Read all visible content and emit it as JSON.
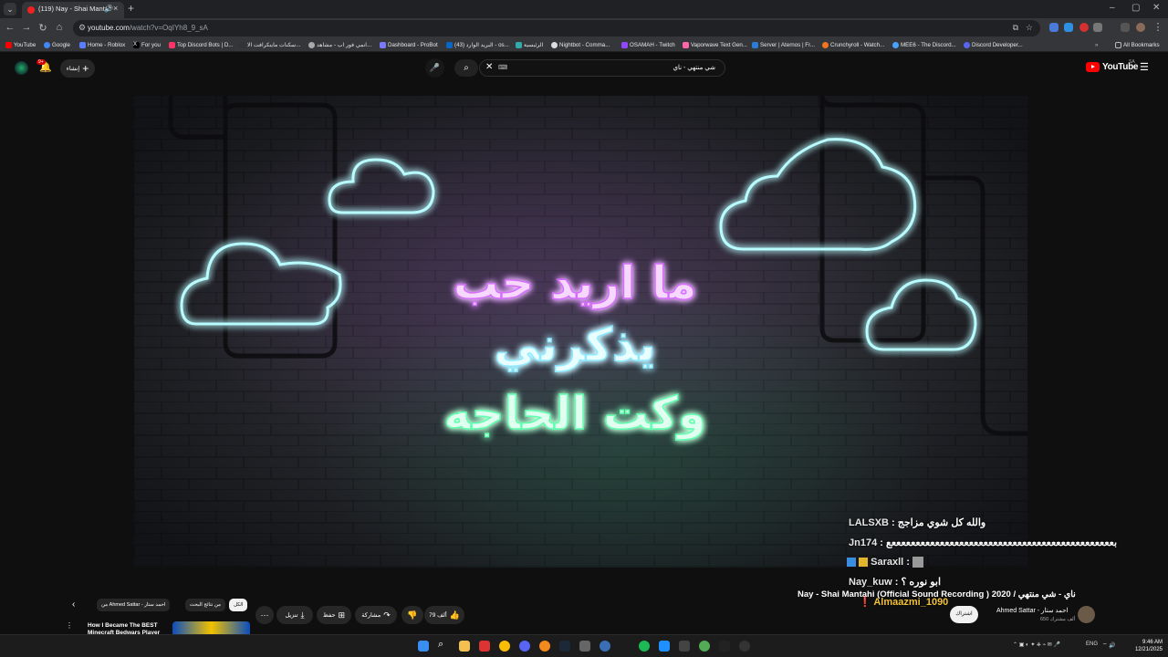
{
  "browser": {
    "tab_title": "(119) Nay - Shai Mantahi (",
    "url_host": "youtube.com",
    "url_path": "/watch?v=OqIYh8_9_sA",
    "bookmarks": [
      "YouTube",
      "Google",
      "Home - Roblox",
      "For you",
      "Top Discord Bots | D...",
      "سكنات ماينكرافت الا...",
      "انمي فور اب - مشاهد...",
      "Dashboard - ProBot",
      "البريد الوارد (43) - os...",
      "الرئيسية",
      "Nightbot - Comma...",
      "OSAMAH - Twitch",
      "Vaporwave Text Gen...",
      "Server | Aternos | Fr...",
      "Crunchyroll - Watch...",
      "MEE6 - The Discord...",
      "Discord Developer..."
    ],
    "all_bookmarks": "All Bookmarks"
  },
  "youtube": {
    "logo_text": "YouTube",
    "region": "SA",
    "search_query": "شي منتهي - ناي",
    "create_label": "إنشاء",
    "notif_count": "9+"
  },
  "video": {
    "lyrics": [
      "ما اريد حب",
      "يذكرني",
      "وكت الحاجه"
    ],
    "title": "Nay - Shai Mantahi (Official Sound Recording ) 2020 / ناي - شي منتهي",
    "channel": "Ahmed Sattar - احمد ستار",
    "subs": "650 ألف مشترك",
    "subscribe": "اشتراك",
    "likes": "79 ألف",
    "share": "مشاركة",
    "save": "حفظ",
    "download": "تنزيل"
  },
  "chat": [
    {
      "user": "LALSXB",
      "msg": "والله كل شوي مزاجج"
    },
    {
      "user": "Jn174",
      "msg": "بععععععععععععععععععععععععععععععععععععععععععععععع"
    },
    {
      "user": "Saraxll",
      "msg": ""
    },
    {
      "user": "Nay_kuw",
      "msg": "ابو نوره ؟"
    },
    {
      "user": "Almaazmi_1090",
      "msg": ""
    }
  ],
  "chips": [
    "الكل",
    "من نتائج البحث",
    "من Ahmed Sattar - احمد ستار"
  ],
  "recommendation": {
    "title": "How I Became The BEST Minecraft Bedwars Player"
  },
  "taskbar": {
    "lang": "ENG",
    "time": "9:46 AM",
    "date": "12/21/2025"
  },
  "colors": {
    "accent": "#ff0000",
    "neon_purple": "#e070ff",
    "neon_cyan": "#9ff4ff",
    "neon_green": "#62ffb0"
  }
}
